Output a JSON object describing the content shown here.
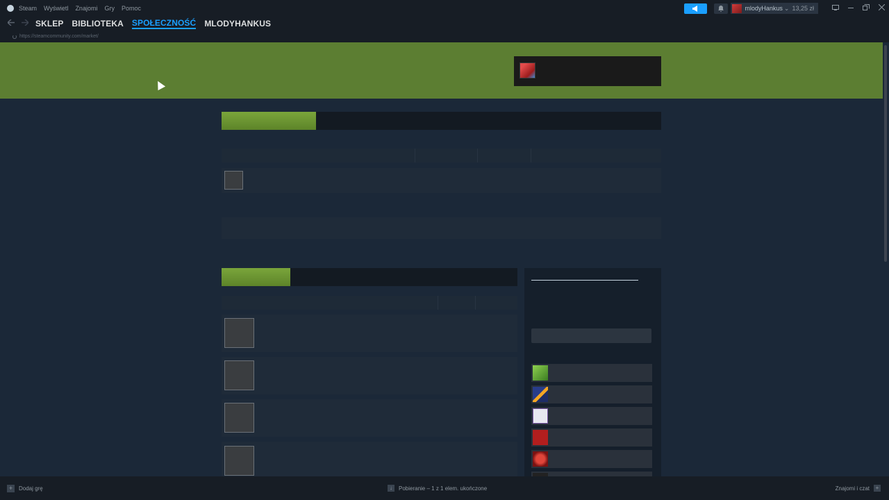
{
  "menubar": {
    "app_name": "Steam",
    "items": [
      "Wyświetl",
      "Znajomi",
      "Gry",
      "Pomoc"
    ],
    "announce_icon": "megaphone-icon",
    "bell_icon": "bell-icon",
    "account_name": "mlodyHankus",
    "account_arrow": "⌄",
    "balance": "13,25 zł"
  },
  "nav": {
    "back_icon": "arrow-left-icon",
    "forward_icon": "arrow-right-icon",
    "links": [
      "SKLEP",
      "BIBLIOTEKA",
      "SPOŁECZNOŚĆ",
      "MLODYHANKUS"
    ],
    "active": "SPOŁECZNOŚĆ",
    "url": "https://steamcommunity.com/market/"
  },
  "statusbar": {
    "add_game": "Dodaj grę",
    "downloads": "Pobieranie – 1 z 1 elem. ukończone",
    "friends": "Znajomi i czat"
  },
  "colors": {
    "accent": "#1a9fff",
    "banner_green": "#5c7e32",
    "tab_green": "#6d9636",
    "background": "#1b2838"
  },
  "sidebar_games": [
    "game-icon-green",
    "game-icon-blue-orange",
    "game-icon-white",
    "game-icon-red-dota",
    "game-icon-red-logo",
    "game-icon-dark"
  ]
}
